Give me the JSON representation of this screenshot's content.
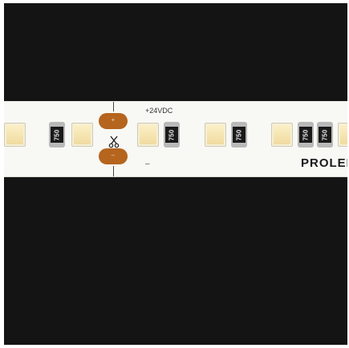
{
  "strip": {
    "voltage_label": "+24VDC",
    "minus_label": "–",
    "pad_top_label": "+",
    "pad_bottom_label": "–",
    "brand": "PROLEI",
    "resistor_code": "750"
  },
  "colors": {
    "background": "#141414",
    "strip": "#f8f8f5",
    "copper_pad": "#b5651d",
    "led_phosphor": "#f0dba0"
  },
  "icons": [
    "scissors-icon"
  ]
}
